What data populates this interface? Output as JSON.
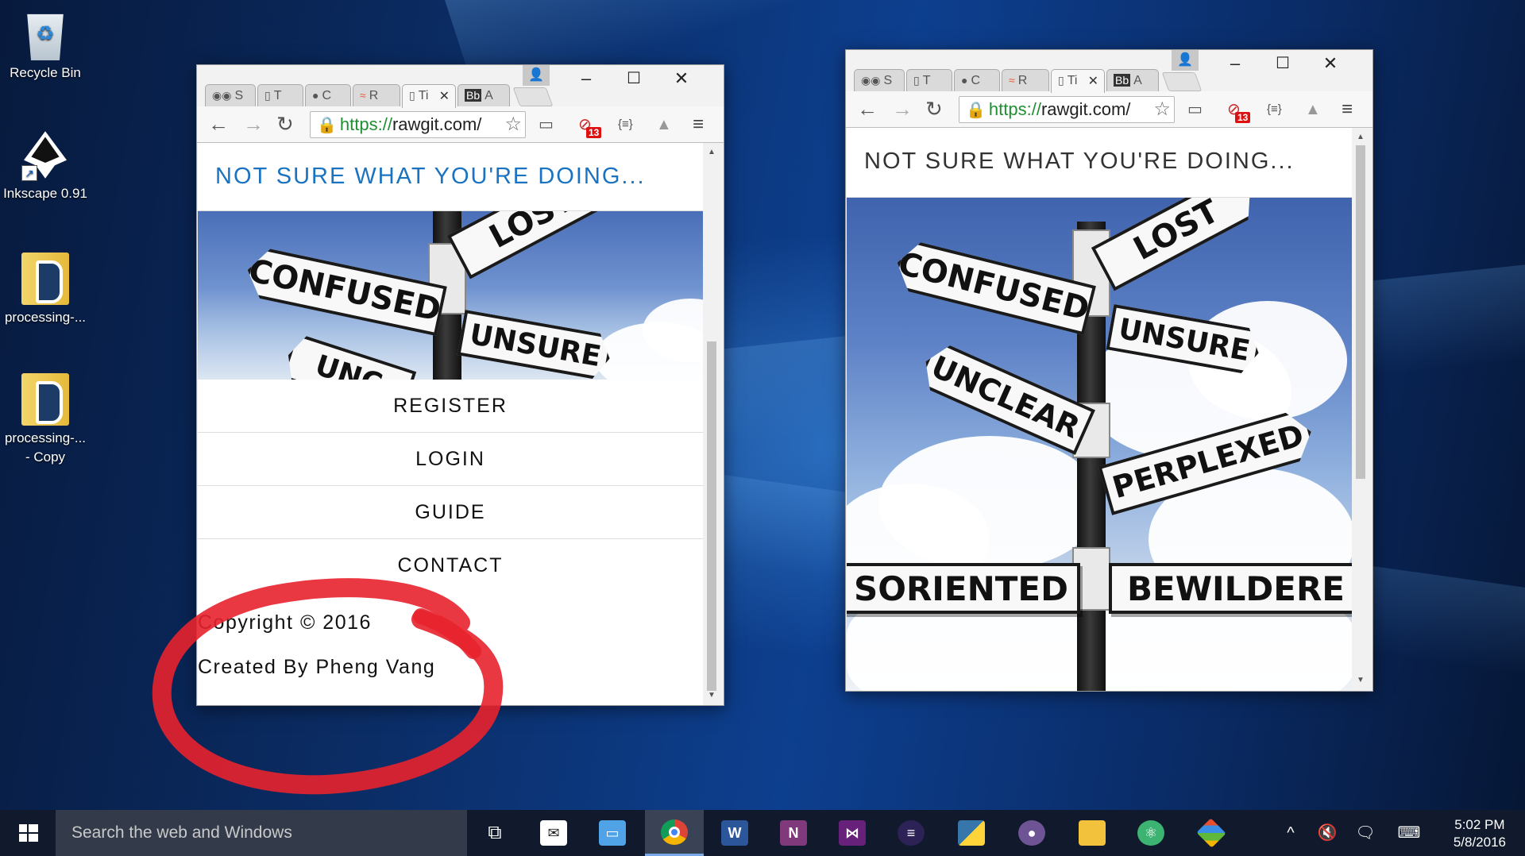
{
  "desktop": {
    "icons": [
      {
        "label": "Recycle Bin"
      },
      {
        "label": "Inkscape 0.91"
      },
      {
        "label": "processing-..."
      },
      {
        "label": "processing-...",
        "label2": "- Copy"
      }
    ]
  },
  "left_window": {
    "tabs": [
      {
        "label": "S",
        "icon": "eye-icon"
      },
      {
        "label": "T",
        "icon": "page-icon"
      },
      {
        "label": "C",
        "icon": "github-icon"
      },
      {
        "label": "R",
        "icon": "fish-icon"
      },
      {
        "label": "Ti",
        "icon": "page-icon",
        "active": true
      },
      {
        "label": "A",
        "icon": "blackboard-icon"
      }
    ],
    "url_protocol": "https://",
    "url_host": "rawgit.com/",
    "badge_count": "13",
    "site_header": "NOT SURE WHAT YOU'RE DOING...",
    "header_color": "#1a73c1",
    "menu": [
      "REGISTER",
      "LOGIN",
      "GUIDE",
      "CONTACT"
    ],
    "footer": {
      "copyright": "Copyright © 2016",
      "author": "Created By Pheng Vang"
    },
    "signs": {
      "lost": "LOST",
      "confused": "CONFUSED",
      "unsure": "UNSURE",
      "unclear": "UNC"
    }
  },
  "right_window": {
    "tabs": [
      {
        "label": "S",
        "icon": "eye-icon"
      },
      {
        "label": "T",
        "icon": "page-icon"
      },
      {
        "label": "C",
        "icon": "github-icon"
      },
      {
        "label": "R",
        "icon": "fish-icon"
      },
      {
        "label": "Ti",
        "icon": "page-icon",
        "active": true
      },
      {
        "label": "A",
        "icon": "blackboard-icon"
      }
    ],
    "url_protocol": "https://",
    "url_host": "rawgit.com/",
    "badge_count": "13",
    "site_header": "NOT SURE WHAT YOU'RE DOING...",
    "header_color": "#333333",
    "signs": {
      "lost": "LOST",
      "confused": "CONFUSED",
      "unsure": "UNSURE",
      "unclear": "UNCLEAR",
      "perplexed": "PERPLEXED",
      "disoriented": "SORIENTED",
      "bewildered": "BEWILDERE"
    }
  },
  "taskbar": {
    "search_placeholder": "Search the web and Windows",
    "apps": [
      "task-view",
      "mail",
      "network",
      "chrome",
      "word",
      "onenote",
      "visual-studio",
      "eclipse",
      "python",
      "github",
      "file-explorer",
      "atom",
      "git"
    ],
    "time": "5:02 PM",
    "date": "5/8/2016"
  },
  "colors": {
    "annotation": "#e8222e",
    "taskbar": "#101a2c"
  }
}
